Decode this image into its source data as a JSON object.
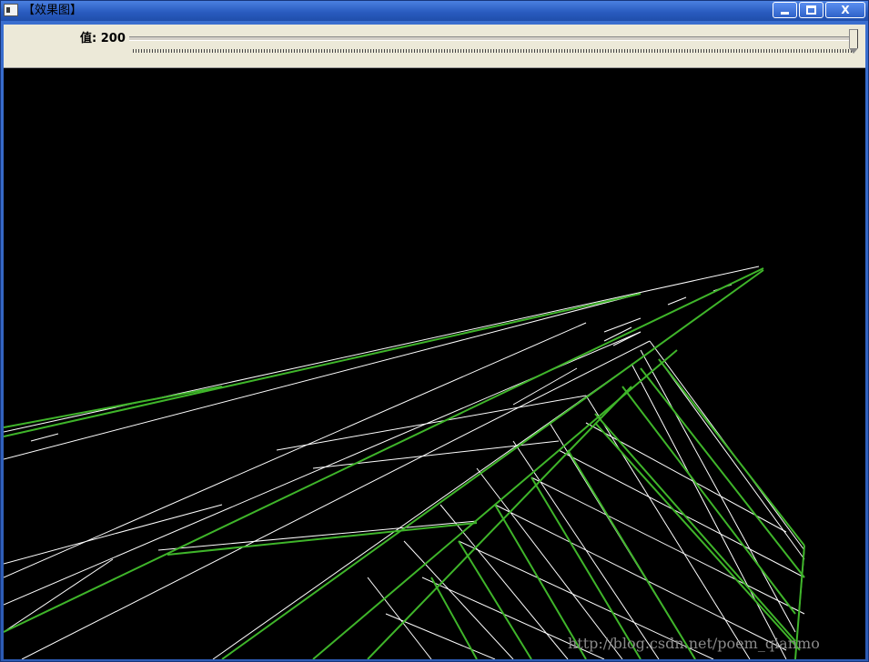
{
  "window": {
    "title": "【效果图】",
    "minimize_glyph": "minimize-icon",
    "maximize_glyph": "maximize-icon",
    "close_label": "X"
  },
  "toolbar": {
    "trackbar_label": "值: 200",
    "trackbar_value": 200,
    "trackbar_fraction": 1.0
  },
  "image": {
    "background": "#000000",
    "edge_color": "#ffffff",
    "line_color": "#3fb52a",
    "watermark": "http://blog.csdn.net/poem_qianmo"
  }
}
